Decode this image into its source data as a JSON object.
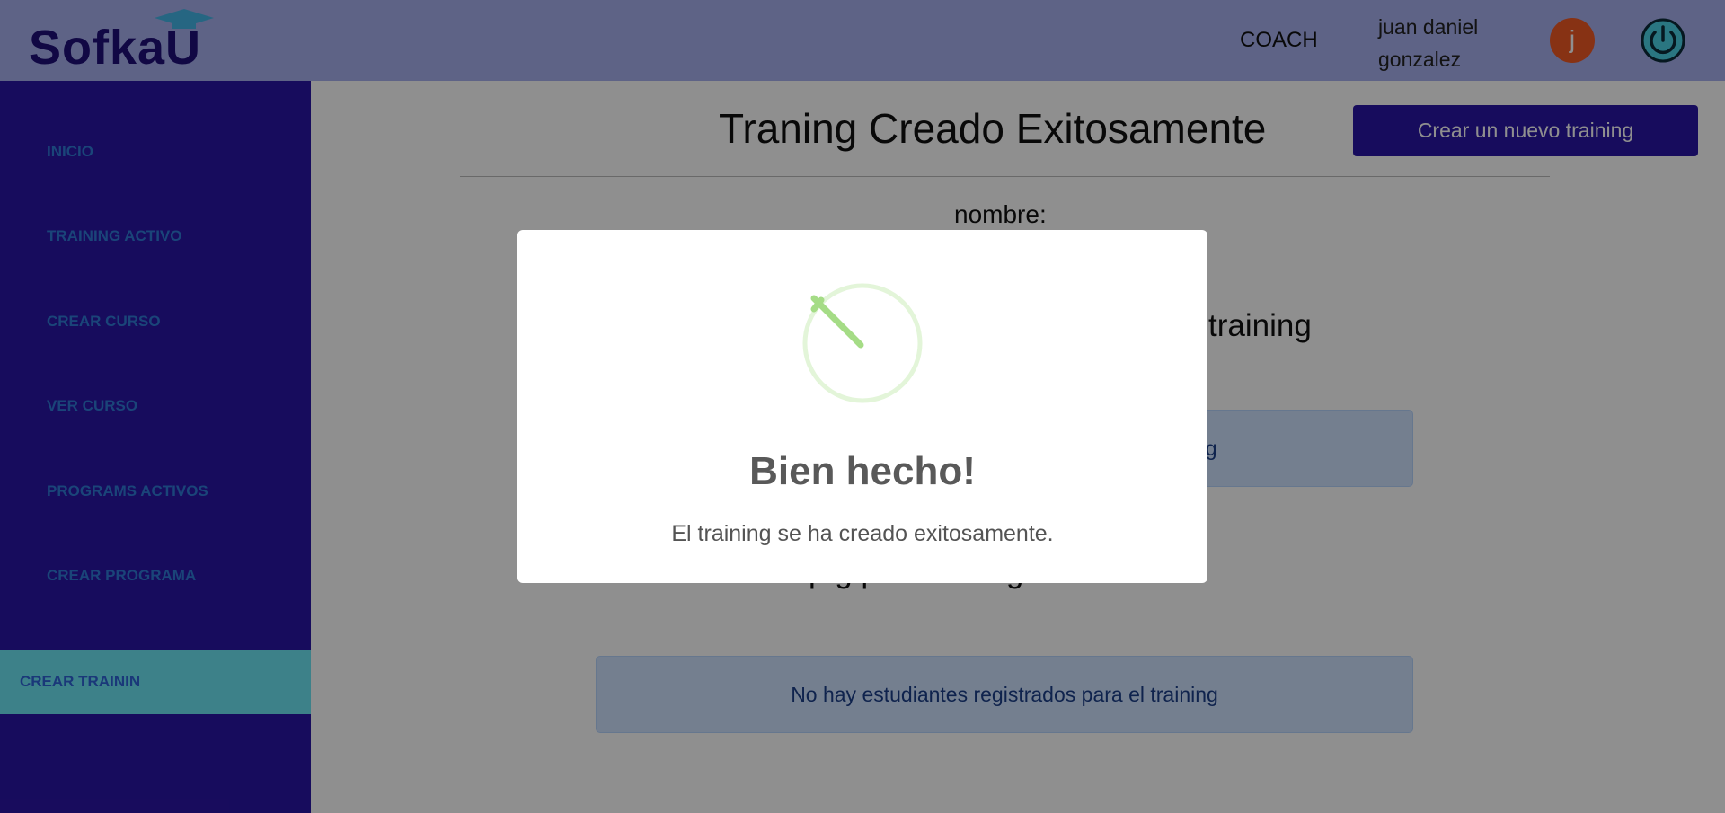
{
  "header": {
    "logo_text": "SofkaU",
    "role": "COACH",
    "username": "juan daniel gonzalez",
    "avatar_initial": "j",
    "bg_color": "#a8b0ef"
  },
  "sidebar": {
    "items": [
      {
        "label": "INICIO",
        "active": false
      },
      {
        "label": "TRAINING ACTIVO",
        "active": false
      },
      {
        "label": "CREAR CURSO",
        "active": false
      },
      {
        "label": "VER CURSO",
        "active": false
      },
      {
        "label": "PROGRAMS ACTIVOS",
        "active": false
      },
      {
        "label": "CREAR PROGRAMA",
        "active": false
      },
      {
        "label": "CREAR TRAININ",
        "active": true
      }
    ],
    "bg_color": "#2a16a6",
    "active_color": "#6ee6f4"
  },
  "main": {
    "page_title": "Traning Creado Exitosamente",
    "new_button_label": "Crear un nuevo training",
    "field_label": "nombre:",
    "section_1_visible_text": "training",
    "alert_1_visible_text": "ng",
    "section_2_visible_text": "p                    g             p    el training",
    "alert_2_text": "No hay estudiantes registrados para el training"
  },
  "modal": {
    "icon": "success-check-icon",
    "title": "Bien hecho!",
    "message": "El training se ha creado exitosamente.",
    "icon_color": "#a5dc86"
  }
}
